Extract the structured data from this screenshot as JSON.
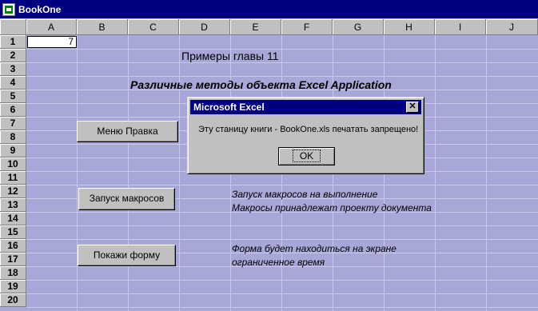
{
  "window": {
    "title": "BookOne"
  },
  "columns": [
    "A",
    "B",
    "C",
    "D",
    "E",
    "F",
    "G",
    "H",
    "I",
    "J"
  ],
  "rows": [
    "1",
    "2",
    "3",
    "4",
    "5",
    "6",
    "7",
    "8",
    "9",
    "10",
    "11",
    "12",
    "13",
    "14",
    "15",
    "16",
    "17",
    "18",
    "19",
    "20"
  ],
  "cells": {
    "a1": "7"
  },
  "sheet": {
    "heading1": "Примеры главы 11",
    "heading2": "Различные методы объекта Excel Application",
    "note1": "Запуск макросов на выполнение",
    "note2": "Макросы принадлежат проекту документа",
    "note3": "Форма будет находиться на экране",
    "note4": "ограниченное время"
  },
  "buttons": {
    "menu": "Меню Правка",
    "macro": "Запуск макросов",
    "form": "Покажи форму"
  },
  "dialog": {
    "title": "Microsoft Excel",
    "close": "✕",
    "message": "Эту станицу книги - BookOne.xls печатать запрещено!",
    "ok": "OK"
  }
}
